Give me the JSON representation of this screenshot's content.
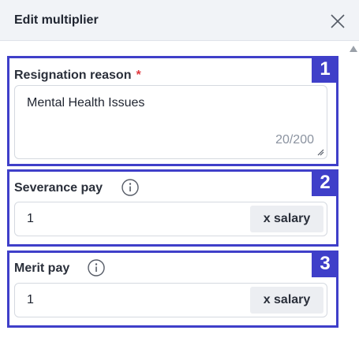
{
  "header": {
    "title": "Edit multiplier",
    "close_icon": "close-icon"
  },
  "sections": [
    {
      "badge": "1",
      "label": "Resignation reason",
      "required_mark": "*",
      "value": "Mental Health Issues",
      "counter": "20/200"
    },
    {
      "badge": "2",
      "label": "Severance pay",
      "info_icon": "info-icon",
      "value": "1",
      "suffix": "x salary"
    },
    {
      "badge": "3",
      "label": "Merit pay",
      "info_icon": "info-icon",
      "value": "1",
      "suffix": "x salary"
    }
  ],
  "colors": {
    "annotation": "#3f3fc9",
    "required": "#e0383e",
    "header_bg": "#f1f3f7"
  }
}
